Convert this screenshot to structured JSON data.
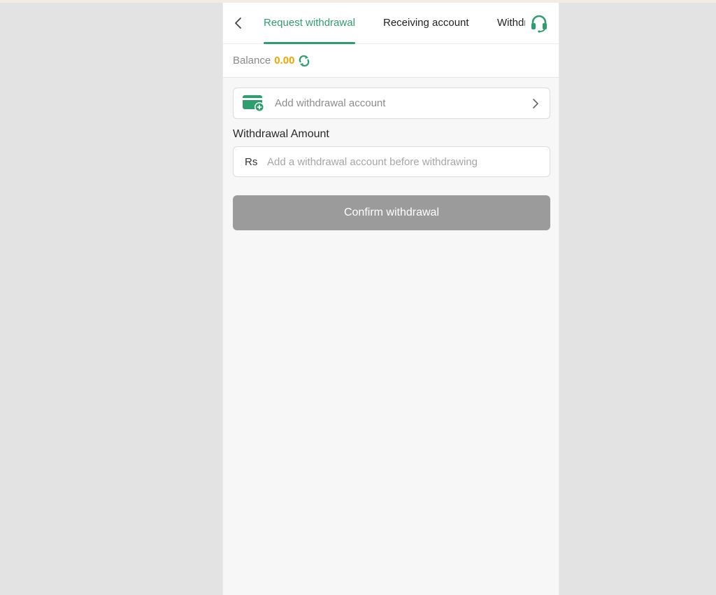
{
  "header": {
    "tabs": [
      {
        "label": "Request withdrawal",
        "active": true
      },
      {
        "label": "Receiving account",
        "active": false
      },
      {
        "label": "Withdrawal history",
        "active": false
      }
    ],
    "back_icon": "chevron-left-icon",
    "support_icon": "headset-icon"
  },
  "balance": {
    "label": "Balance",
    "value": "0.00",
    "refresh_icon": "refresh-icon"
  },
  "account": {
    "label": "Add withdrawal account",
    "icon": "card-add-icon",
    "arrow_icon": "chevron-right-icon"
  },
  "amount": {
    "label": "Withdrawal Amount",
    "currency": "Rs",
    "value": "",
    "placeholder": "Add a withdrawal account before withdrawing"
  },
  "confirm": {
    "label": "Confirm withdrawal"
  },
  "colors": {
    "accent": "#2f9e6e",
    "balance": "#f0a500",
    "button_disabled": "#9b9b9b",
    "outer_background": "#e3e3e3",
    "page_background": "#f7f7f7"
  }
}
